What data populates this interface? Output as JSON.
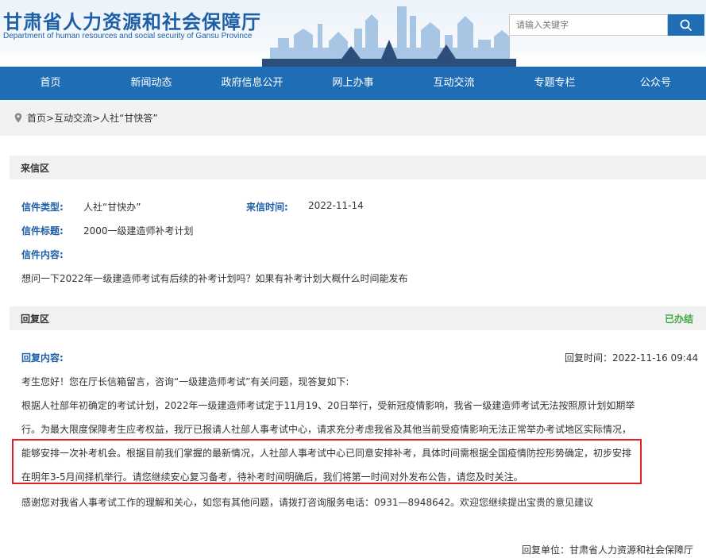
{
  "header": {
    "title": "甘肃省人力资源和社会保障厅",
    "subtitle": "Department of human resources and social security of Gansu Province",
    "search_placeholder": "请输入关键字"
  },
  "nav": [
    "首页",
    "新闻动态",
    "政府信息公开",
    "网上办事",
    "互动交流",
    "专题专栏",
    "公众号"
  ],
  "breadcrumb": {
    "home": "首页",
    "sep1": ">",
    "interact": "互动交流",
    "sep2": ">",
    "current": "人社“甘快答”"
  },
  "letter": {
    "section_title": "来信区",
    "type_label": "信件类型:",
    "type_value": "人社“甘快办”",
    "time_label": "来信时间:",
    "time_value": "2022-11-14",
    "subject_label": "信件标题:",
    "subject_value": "2000一级建造师补考计划",
    "content_label": "信件内容:",
    "content_value": "想问一下2022年一级建造师考试有后续的补考计划吗？如果有补考计划大概什么时间能发布"
  },
  "reply": {
    "section_title": "回复区",
    "status": "已办结",
    "content_label": "回复内容:",
    "time_text": "回复时间：2022-11-16 09:44",
    "greeting": "考生您好！您在厅长信箱留言，咨询“一级建造师考试”有关问题，现答复如下:",
    "para_line1": "根据人社部年初确定的考试计划，2022年一级建造师考试定于11月19、20日举行，受新冠疫情影响，我省一级建造师考试无法按照原计划如期举",
    "para_line2": "行。为最大限度保障考生应考权益，我厅已报请人社部人事考试中心，请求充分考虑我省及其他当前受疫情影响无法正常举办考试地区实际情况，",
    "para_line3": "能够安排一次补考机会。根据目前我们掌握的最新情况，人社部人事考试中心已同意安排补考，具体时间需根据全国疫情防控形势确定，初步安排",
    "para_line4": "在明年3-5月间择机举行。请您继续安心复习备考，待补考时间明确后，我们将第一时间对外发布公告，请您及时关注。",
    "thanks": "感谢您对我省人事考试工作的理解和关心，如您有其他问题，请拨打咨询服务电话：0931—8948642。欢迎您继续提出宝贵的意见建议",
    "unit_text": "回复单位：甘肃省人力资源和社会保障厅"
  },
  "colors": {
    "brand": "#1f6db5",
    "highlight": "#e02020",
    "done": "#3fab3f"
  }
}
